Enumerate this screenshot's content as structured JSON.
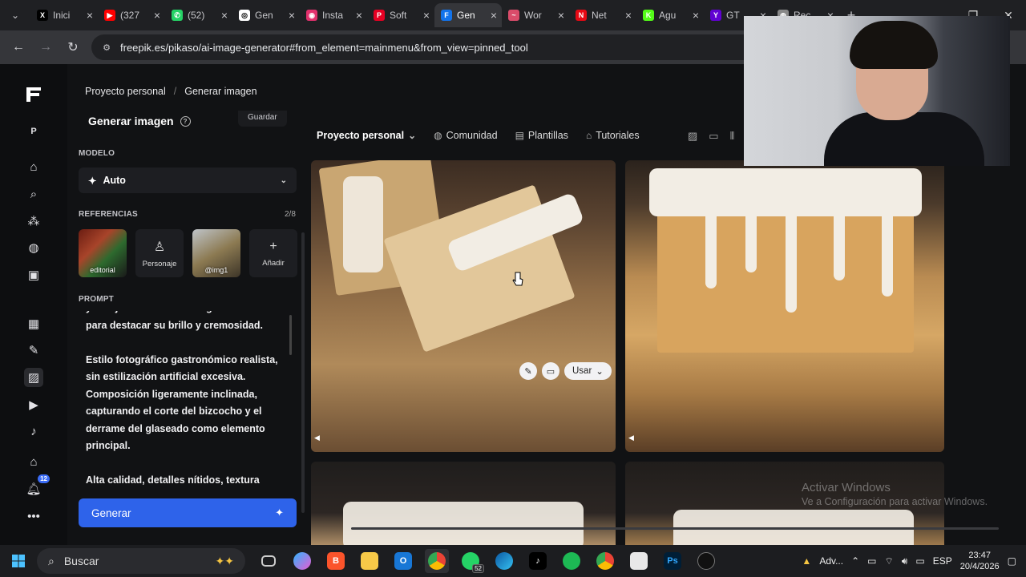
{
  "browser": {
    "tabs": [
      {
        "title": "Inici",
        "icon": "x-logo-icon",
        "color": "#000000"
      },
      {
        "title": "(327",
        "icon": "youtube-icon",
        "color": "#ff0000"
      },
      {
        "title": "(52)",
        "icon": "whatsapp-icon",
        "color": "#25d366"
      },
      {
        "title": "Gen",
        "icon": "openai-icon",
        "color": "#ffffff"
      },
      {
        "title": "Insta",
        "icon": "instagram-icon",
        "color": "#e1306c"
      },
      {
        "title": "Soft",
        "icon": "pinterest-icon",
        "color": "#e60023"
      },
      {
        "title": "Gen",
        "icon": "freepik-icon",
        "color": "#1273eb",
        "active": true
      },
      {
        "title": "Wor",
        "icon": "tool-icon",
        "color": "#d94c6a"
      },
      {
        "title": "Net",
        "icon": "netflix-icon",
        "color": "#e50914"
      },
      {
        "title": "Agu",
        "icon": "k-icon",
        "color": "#53fc18"
      },
      {
        "title": "GT",
        "icon": "yahoo-icon",
        "color": "#6001d2"
      },
      {
        "title": "Rec",
        "icon": "globe-icon",
        "color": "#888888"
      }
    ],
    "url": "freepik.es/pikaso/ai-image-generator#from_element=mainmenu&from_view=pinned_tool"
  },
  "app": {
    "breadcrumb": [
      "Proyecto personal",
      "Generar imagen"
    ],
    "panel_title": "Generar imagen",
    "save_label": "Guardar",
    "rail_logo_letter": "P",
    "notification_count": "12",
    "model_label": "MODELO",
    "model_value": "Auto",
    "references_label": "REFERENCIAS",
    "references_count": "2/8",
    "references": [
      {
        "label": "editorial"
      },
      {
        "label": "Personaje"
      },
      {
        "label": "@img1"
      },
      {
        "label": "Añadir"
      }
    ],
    "prompt_label": "PROMPT",
    "prompt_text": "y reflejos en el borde del glaseado\npara destacar su brillo y cremosidad.\n\nEstilo fotográfico gastronómico realista, sin estilización artificial excesiva. Composición ligeramente inclinada, capturando el corte del bizcocho y el derrame del glaseado como elemento principal.\n\nAlta calidad, detalles nítidos, textura",
    "generate_label": "Generar",
    "topnav": {
      "project": "Proyecto personal",
      "items": [
        "Comunidad",
        "Plantillas",
        "Tutoriales"
      ]
    },
    "tile_use_label": "Usar"
  },
  "windows_watermark": {
    "line1": "Activar Windows",
    "line2": "Ve a Configuración para activar Windows."
  },
  "taskbar": {
    "search_placeholder": "Buscar",
    "whatsapp_badge": "52",
    "tray_app": "Adv...",
    "language": "ESP",
    "time": "23:47",
    "date": "20/4/2026"
  }
}
